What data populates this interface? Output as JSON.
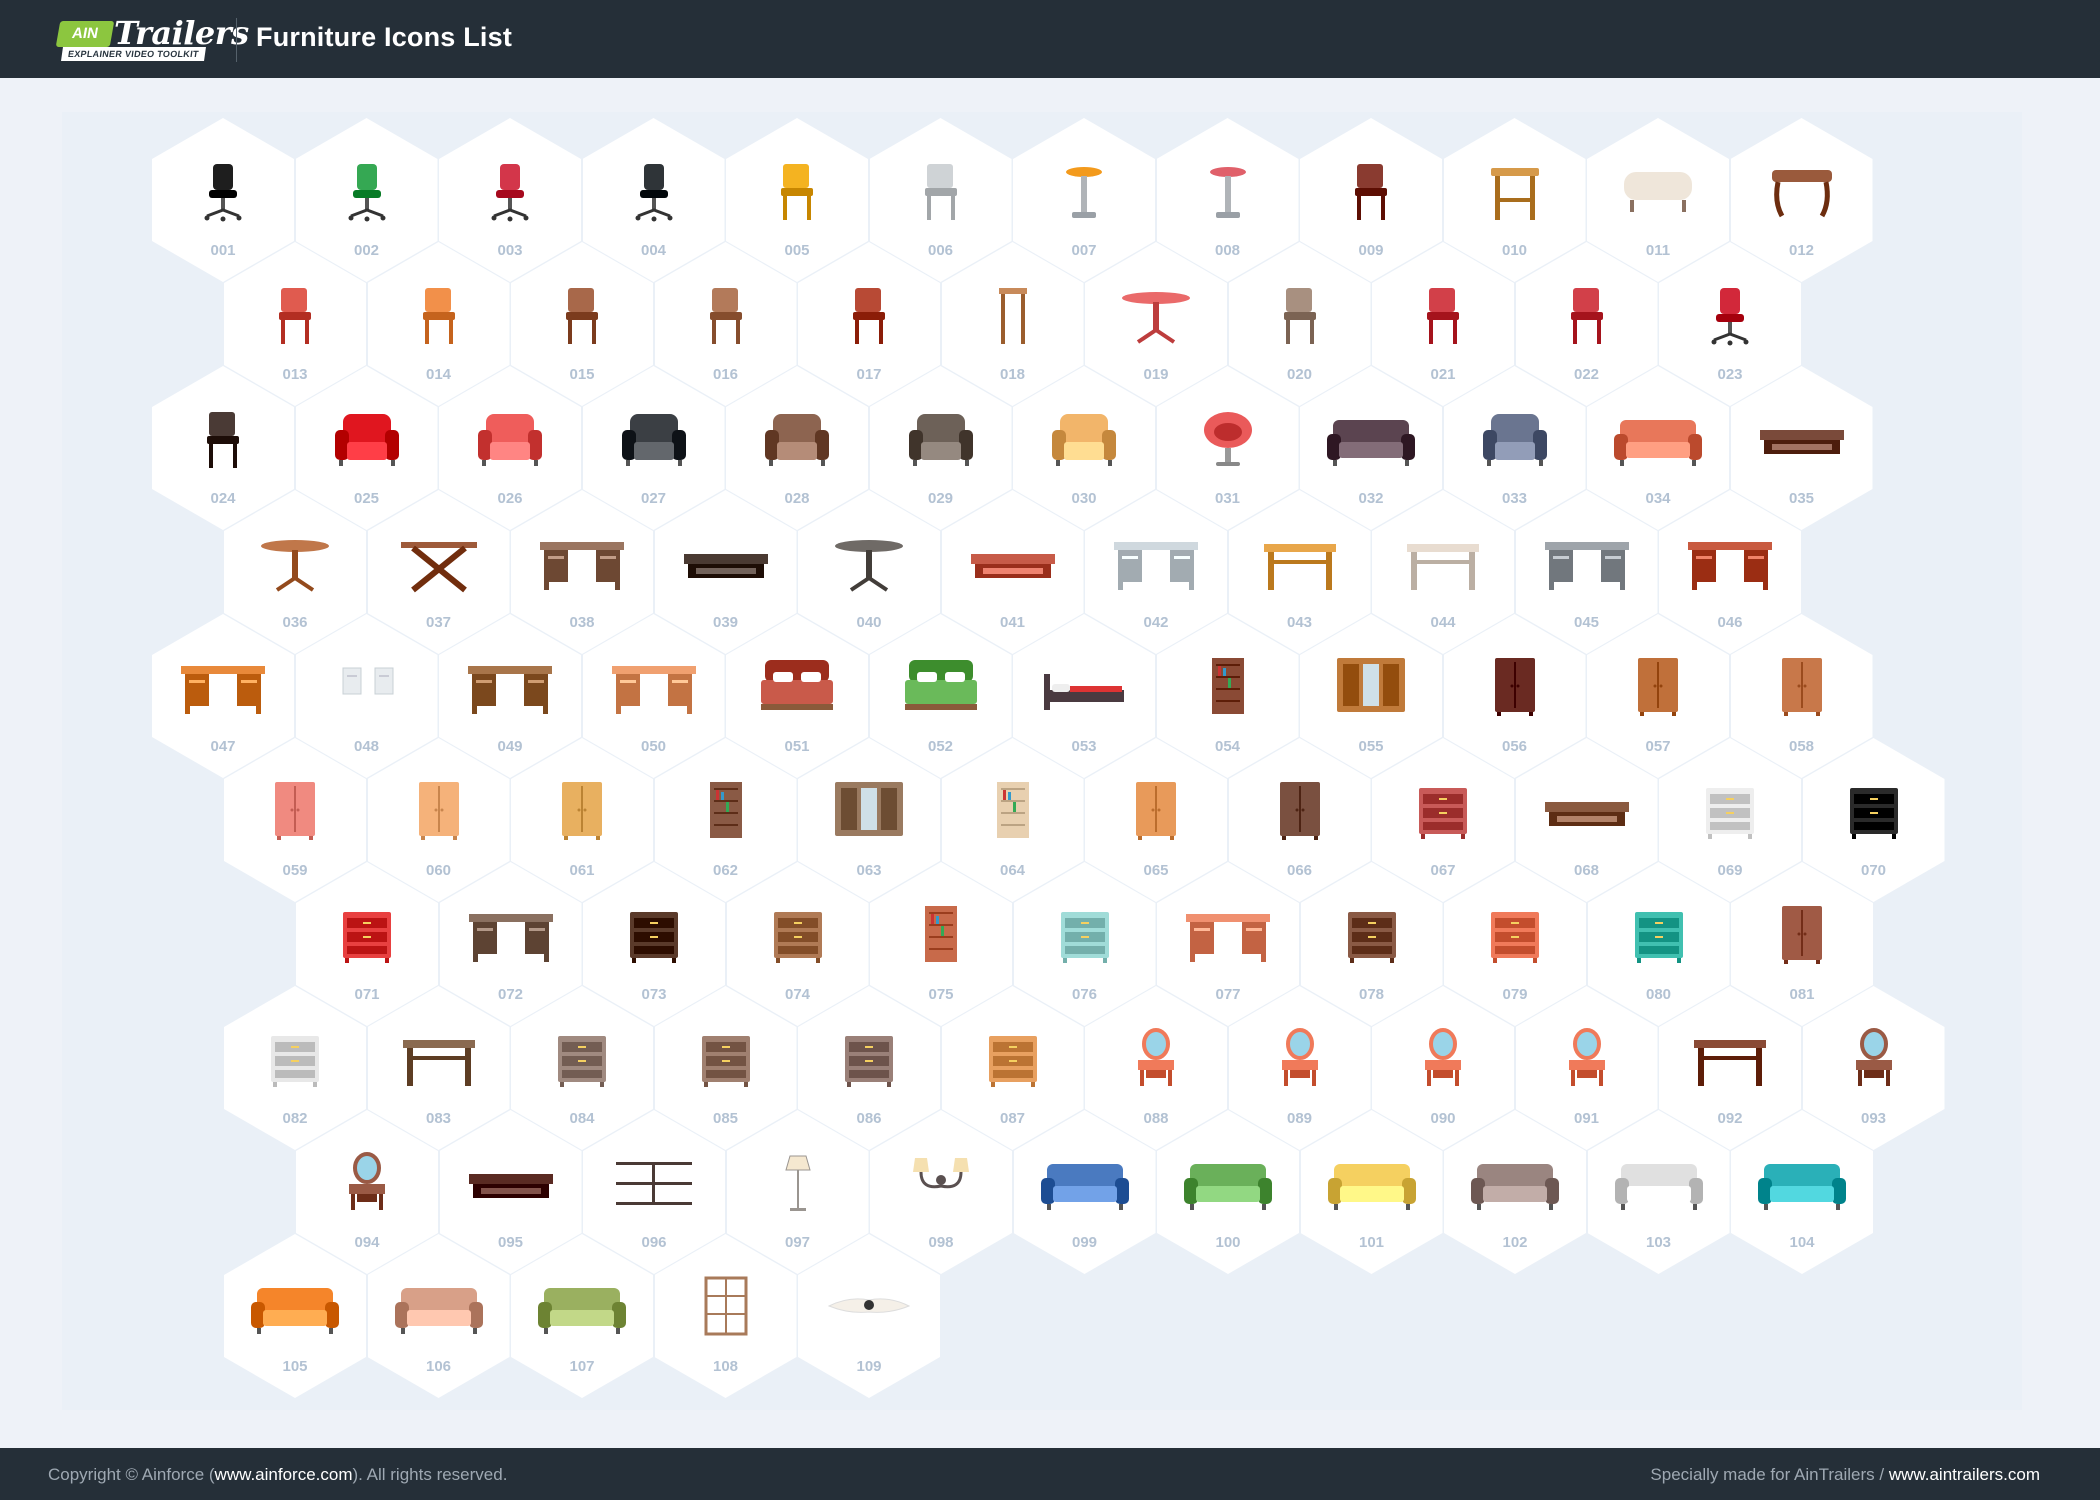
{
  "header": {
    "logo_badge": "AIN",
    "logo_word": "Trailers",
    "logo_tagline": "EXPLAINER VIDEO TOOLKIT",
    "title": "Furniture Icons List"
  },
  "icons": [
    {
      "num": "001",
      "icon": "office-chair-black-icon",
      "shape": "chair_office",
      "color": "#1e1e1e"
    },
    {
      "num": "002",
      "icon": "office-chair-green-icon",
      "shape": "chair_office",
      "color": "#35a853"
    },
    {
      "num": "003",
      "icon": "office-chair-red-icon",
      "shape": "chair_office",
      "color": "#d3364a"
    },
    {
      "num": "004",
      "icon": "executive-chair-icon",
      "shape": "chair_office",
      "color": "#2f3438"
    },
    {
      "num": "005",
      "icon": "yellow-chair-icon",
      "shape": "chair",
      "color": "#f4b321"
    },
    {
      "num": "006",
      "icon": "metal-chair-icon",
      "shape": "chair",
      "color": "#cfd3d6"
    },
    {
      "num": "007",
      "icon": "bar-stool-orange-icon",
      "shape": "stool",
      "color": "#f39a1c"
    },
    {
      "num": "008",
      "icon": "bar-stool-icon",
      "shape": "stool",
      "color": "#e0606a"
    },
    {
      "num": "009",
      "icon": "wooden-chair-brown-icon",
      "shape": "chair",
      "color": "#8a3b30"
    },
    {
      "num": "010",
      "icon": "wooden-stool-icon",
      "shape": "stool_wide",
      "color": "#d69a4a"
    },
    {
      "num": "011",
      "icon": "ottoman-icon",
      "shape": "ottoman",
      "color": "#efe6da"
    },
    {
      "num": "012",
      "icon": "bench-icon",
      "shape": "bench",
      "color": "#9a5a3c"
    },
    {
      "num": "013",
      "icon": "cantilever-chair-icon",
      "shape": "chair",
      "color": "#e05b4f"
    },
    {
      "num": "014",
      "icon": "orange-chair-icon",
      "shape": "chair",
      "color": "#f2904a"
    },
    {
      "num": "015",
      "icon": "wooden-chair-icon",
      "shape": "chair",
      "color": "#a8684a"
    },
    {
      "num": "016",
      "icon": "round-back-chair-icon",
      "shape": "chair",
      "color": "#b37a5a"
    },
    {
      "num": "017",
      "icon": "windsor-chair-icon",
      "shape": "chair",
      "color": "#b84a35"
    },
    {
      "num": "018",
      "icon": "tall-stool-icon",
      "shape": "stool_tall",
      "color": "#c88a5a"
    },
    {
      "num": "019",
      "icon": "folding-table-icon",
      "shape": "table_round",
      "color": "#ea6a6a"
    },
    {
      "num": "020",
      "icon": "ladder-back-chair-icon",
      "shape": "chair",
      "color": "#a89080"
    },
    {
      "num": "021",
      "icon": "red-armchair-icon",
      "shape": "chair",
      "color": "#d24049"
    },
    {
      "num": "022",
      "icon": "dining-chair-red-icon",
      "shape": "chair",
      "color": "#d24049"
    },
    {
      "num": "023",
      "icon": "egg-chair-icon",
      "shape": "chair_office",
      "color": "#d2283a"
    },
    {
      "num": "024",
      "icon": "spindle-chair-icon",
      "shape": "chair",
      "color": "#4a3a35"
    },
    {
      "num": "025",
      "icon": "red-armchair-icon",
      "shape": "armchair",
      "color": "#e0161f"
    },
    {
      "num": "026",
      "icon": "coral-armchair-icon",
      "shape": "armchair",
      "color": "#ef5d5b"
    },
    {
      "num": "027",
      "icon": "black-armchair-icon",
      "shape": "armchair",
      "color": "#3b3f44"
    },
    {
      "num": "028",
      "icon": "brown-armchair-icon",
      "shape": "armchair",
      "color": "#8d6450"
    },
    {
      "num": "029",
      "icon": "grey-armchair-icon",
      "shape": "armchair",
      "color": "#6d6158"
    },
    {
      "num": "030",
      "icon": "rattan-chair-icon",
      "shape": "armchair",
      "color": "#f2b56a"
    },
    {
      "num": "031",
      "icon": "pod-chair-icon",
      "shape": "pod",
      "color": "#ea5a5a"
    },
    {
      "num": "032",
      "icon": "loveseat-icon",
      "shape": "sofa",
      "color": "#5b4450"
    },
    {
      "num": "033",
      "icon": "wingback-chair-icon",
      "shape": "armchair",
      "color": "#6a7590"
    },
    {
      "num": "034",
      "icon": "coral-sofa-icon",
      "shape": "sofa",
      "color": "#e8775a"
    },
    {
      "num": "035",
      "icon": "daybed-icon",
      "shape": "low_table",
      "color": "#7a4a3a"
    },
    {
      "num": "036",
      "icon": "round-table-icon",
      "shape": "table_round",
      "color": "#c0774a"
    },
    {
      "num": "037",
      "icon": "trestle-table-icon",
      "shape": "table_x",
      "color": "#9e5a3a"
    },
    {
      "num": "038",
      "icon": "oval-desk-icon",
      "shape": "desk",
      "color": "#9a7560"
    },
    {
      "num": "039",
      "icon": "coffee-table-icon",
      "shape": "low_table",
      "color": "#4a3a32"
    },
    {
      "num": "040",
      "icon": "pedestal-table-icon",
      "shape": "table_round",
      "color": "#6f6a66"
    },
    {
      "num": "041",
      "icon": "glass-coffee-table-icon",
      "shape": "low_table",
      "color": "#c75b48"
    },
    {
      "num": "042",
      "icon": "glass-desk-icon",
      "shape": "desk",
      "color": "#cfd8de"
    },
    {
      "num": "043",
      "icon": "wooden-table-icon",
      "shape": "table",
      "color": "#e8a64a"
    },
    {
      "num": "044",
      "icon": "tablecloth-table-icon",
      "shape": "table",
      "color": "#e8dcd0"
    },
    {
      "num": "045",
      "icon": "office-desk-icon",
      "shape": "desk",
      "color": "#9ea4aa"
    },
    {
      "num": "046",
      "icon": "writing-desk-icon",
      "shape": "desk",
      "color": "#c85a40"
    },
    {
      "num": "047",
      "icon": "computer-desk-icon",
      "shape": "desk",
      "color": "#e8893a"
    },
    {
      "num": "048",
      "icon": "wall-cabinets-icon",
      "shape": "panels",
      "color": "#e8ecef"
    },
    {
      "num": "049",
      "icon": "drawer-desk-icon",
      "shape": "desk",
      "color": "#a8754a"
    },
    {
      "num": "050",
      "icon": "peach-desk-icon",
      "shape": "desk",
      "color": "#f0a070"
    },
    {
      "num": "051",
      "icon": "double-bed-icon",
      "shape": "bed",
      "color": "#c95a4a"
    },
    {
      "num": "052",
      "icon": "green-bed-icon",
      "shape": "bed",
      "color": "#6aba5a"
    },
    {
      "num": "053",
      "icon": "single-bed-icon",
      "shape": "bed_low",
      "color": "#4a3a40"
    },
    {
      "num": "054",
      "icon": "bookcase-icon",
      "shape": "bookcase",
      "color": "#8a4a35"
    },
    {
      "num": "055",
      "icon": "wall-unit-icon",
      "shape": "wardrobe_wide",
      "color": "#c07a3a"
    },
    {
      "num": "056",
      "icon": "mirror-wardrobe-icon",
      "shape": "wardrobe",
      "color": "#6a2a22"
    },
    {
      "num": "057",
      "icon": "wooden-wardrobe-icon",
      "shape": "wardrobe",
      "color": "#c0703a"
    },
    {
      "num": "058",
      "icon": "mirror-cabinet-icon",
      "shape": "wardrobe",
      "color": "#c8784a"
    },
    {
      "num": "059",
      "icon": "pink-wardrobe-icon",
      "shape": "wardrobe",
      "color": "#f08a80"
    },
    {
      "num": "060",
      "icon": "tall-cabinet-icon",
      "shape": "wardrobe",
      "color": "#f5b27a"
    },
    {
      "num": "061",
      "icon": "glass-cabinet-icon",
      "shape": "wardrobe",
      "color": "#e8b060"
    },
    {
      "num": "062",
      "icon": "shelf-unit-icon",
      "shape": "bookcase",
      "color": "#8a5a45"
    },
    {
      "num": "063",
      "icon": "sliding-wardrobe-icon",
      "shape": "wardrobe_wide",
      "color": "#9a7a60"
    },
    {
      "num": "064",
      "icon": "narrow-shelf-icon",
      "shape": "bookcase",
      "color": "#e8d0b0"
    },
    {
      "num": "065",
      "icon": "display-cabinet-icon",
      "shape": "wardrobe",
      "color": "#e89a5a"
    },
    {
      "num": "066",
      "icon": "china-cabinet-icon",
      "shape": "wardrobe",
      "color": "#7a5040"
    },
    {
      "num": "067",
      "icon": "chest-cabinet-icon",
      "shape": "drawers",
      "color": "#c85a58"
    },
    {
      "num": "068",
      "icon": "tv-stand-icon",
      "shape": "low_table",
      "color": "#8a5a40"
    },
    {
      "num": "069",
      "icon": "white-dresser-icon",
      "shape": "drawers",
      "color": "#eeeeee"
    },
    {
      "num": "070",
      "icon": "black-dresser-icon",
      "shape": "drawers",
      "color": "#2a2a2a"
    },
    {
      "num": "071",
      "icon": "red-nightstand-icon",
      "shape": "drawers",
      "color": "#e84040"
    },
    {
      "num": "072",
      "icon": "console-desk-icon",
      "shape": "desk",
      "color": "#8a7060"
    },
    {
      "num": "073",
      "icon": "chest-of-drawers-icon",
      "shape": "drawers",
      "color": "#5a3a2a"
    },
    {
      "num": "074",
      "icon": "nightstand-icon",
      "shape": "drawers",
      "color": "#b07a55"
    },
    {
      "num": "075",
      "icon": "shelf-cabinet-icon",
      "shape": "bookcase",
      "color": "#c86a4a"
    },
    {
      "num": "076",
      "icon": "mint-cabinet-icon",
      "shape": "drawers",
      "color": "#a0dcd8"
    },
    {
      "num": "077",
      "icon": "sideboard-icon",
      "shape": "desk",
      "color": "#f09070"
    },
    {
      "num": "078",
      "icon": "radio-cabinet-icon",
      "shape": "drawers",
      "color": "#8a5a45"
    },
    {
      "num": "079",
      "icon": "coral-dresser-icon",
      "shape": "drawers",
      "color": "#f07a5a"
    },
    {
      "num": "080",
      "icon": "teal-nightstand-icon",
      "shape": "drawers",
      "color": "#40c0b0"
    },
    {
      "num": "081",
      "icon": "tall-armoire-icon",
      "shape": "wardrobe",
      "color": "#a05a45"
    },
    {
      "num": "082",
      "icon": "oven-cabinet-icon",
      "shape": "drawers",
      "color": "#e8e8e8"
    },
    {
      "num": "083",
      "icon": "console-table-icon",
      "shape": "table",
      "color": "#8a6a50"
    },
    {
      "num": "084",
      "icon": "filing-cabinet-icon",
      "shape": "drawers",
      "color": "#a08a80"
    },
    {
      "num": "085",
      "icon": "tall-drawers-icon",
      "shape": "drawers",
      "color": "#a08070"
    },
    {
      "num": "086",
      "icon": "grey-drawers-icon",
      "shape": "drawers",
      "color": "#9a8078"
    },
    {
      "num": "087",
      "icon": "wide-dresser-icon",
      "shape": "drawers",
      "color": "#e8a060"
    },
    {
      "num": "088",
      "icon": "mirror-vanity-icon",
      "shape": "vanity",
      "color": "#f07a5a"
    },
    {
      "num": "089",
      "icon": "round-mirror-vanity-icon",
      "shape": "vanity",
      "color": "#f07a5a"
    },
    {
      "num": "090",
      "icon": "oval-mirror-vanity-icon",
      "shape": "vanity",
      "color": "#f07a5a"
    },
    {
      "num": "091",
      "icon": "small-vanity-icon",
      "shape": "vanity",
      "color": "#f07a5a"
    },
    {
      "num": "092",
      "icon": "carved-table-icon",
      "shape": "table",
      "color": "#8a4a35"
    },
    {
      "num": "093",
      "icon": "triple-mirror-vanity-icon",
      "shape": "vanity",
      "color": "#9a5a45"
    },
    {
      "num": "094",
      "icon": "wooden-vanity-icon",
      "shape": "vanity",
      "color": "#9a5a45"
    },
    {
      "num": "095",
      "icon": "low-coffee-table-icon",
      "shape": "low_table",
      "color": "#5a2a22"
    },
    {
      "num": "096",
      "icon": "wall-shelves-icon",
      "shape": "shelves",
      "color": "#4a3a35"
    },
    {
      "num": "097",
      "icon": "floor-lamp-icon",
      "shape": "lamp",
      "color": "#9a9590"
    },
    {
      "num": "098",
      "icon": "wall-sconce-icon",
      "shape": "sconce",
      "color": "#5a5050"
    },
    {
      "num": "099",
      "icon": "blue-sofa-icon",
      "shape": "sofa",
      "color": "#4a7ac0"
    },
    {
      "num": "100",
      "icon": "green-chesterfield-icon",
      "shape": "sofa",
      "color": "#6ab05a"
    },
    {
      "num": "101",
      "icon": "yellow-sofa-icon",
      "shape": "sofa",
      "color": "#f5d060"
    },
    {
      "num": "102",
      "icon": "taupe-sofa-icon",
      "shape": "sofa",
      "color": "#9a8580"
    },
    {
      "num": "103",
      "icon": "white-sofa-icon",
      "shape": "sofa",
      "color": "#e0e0e0"
    },
    {
      "num": "104",
      "icon": "teal-sofa-icon",
      "shape": "sofa",
      "color": "#2ab0b8"
    },
    {
      "num": "105",
      "icon": "orange-sofa-icon",
      "shape": "sofa",
      "color": "#f5852a"
    },
    {
      "num": "106",
      "icon": "cushion-sofa-icon",
      "shape": "sofa",
      "color": "#d8a088"
    },
    {
      "num": "107",
      "icon": "olive-sofa-icon",
      "shape": "sofa",
      "color": "#9ab060"
    },
    {
      "num": "108",
      "icon": "room-divider-icon",
      "shape": "divider",
      "color": "#a87a5a"
    },
    {
      "num": "109",
      "icon": "bear-rug-icon",
      "shape": "rug",
      "color": "#f5f0e8"
    }
  ],
  "footer": {
    "copyright_prefix": "Copyright © Ainforce (",
    "copyright_link": "www.ainforce.com",
    "copyright_suffix": "). All rights reserved.",
    "made_for_prefix": "Specially made for AinTrailers / ",
    "made_for_link": "www.aintrailers.com"
  }
}
